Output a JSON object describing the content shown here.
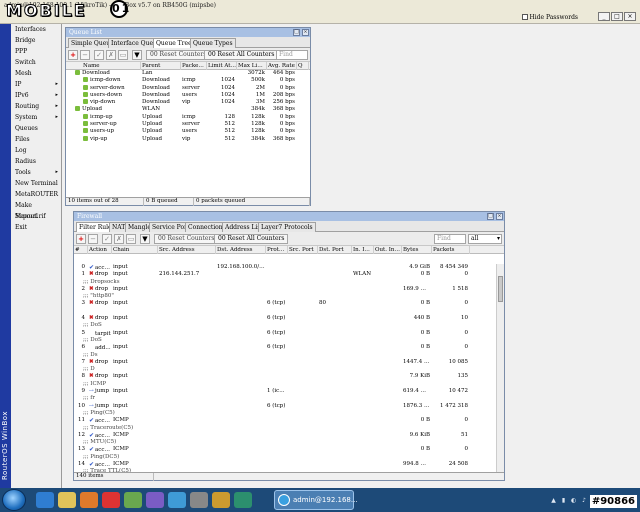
{
  "window": {
    "title": "admin@192.168.100.1 (MikroTik) - WinBox v5.7 on RB450G (mipsbe)",
    "hide_passwords": "Hide Passwords",
    "brand_vertical": "RouterOS WinBox"
  },
  "logo": {
    "text": "MOBILE",
    "badge": "01"
  },
  "menu": [
    {
      "label": "Interfaces",
      "arrow": ""
    },
    {
      "label": "Bridge",
      "arrow": ""
    },
    {
      "label": "PPP",
      "arrow": ""
    },
    {
      "label": "Switch",
      "arrow": ""
    },
    {
      "label": "Mesh",
      "arrow": ""
    },
    {
      "label": "IP",
      "arrow": "▸"
    },
    {
      "label": "IPv6",
      "arrow": "▸"
    },
    {
      "label": "Routing",
      "arrow": "▸"
    },
    {
      "label": "System",
      "arrow": "▸"
    },
    {
      "label": "Queues",
      "arrow": ""
    },
    {
      "label": "Files",
      "arrow": ""
    },
    {
      "label": "Log",
      "arrow": ""
    },
    {
      "label": "Radius",
      "arrow": ""
    },
    {
      "label": "Tools",
      "arrow": "▸"
    },
    {
      "label": "New Terminal",
      "arrow": ""
    },
    {
      "label": "MetaROUTER",
      "arrow": ""
    },
    {
      "label": "Make Supout.rif",
      "arrow": ""
    },
    {
      "label": "Manual",
      "arrow": ""
    },
    {
      "label": "Exit",
      "arrow": ""
    }
  ],
  "queue": {
    "title": "Queue List",
    "tabs": [
      "Simple Queues",
      "Interface Queues",
      "Queue Tree",
      "Queue Types"
    ],
    "active_tab": 2,
    "reset_counters": "Reset Counters",
    "reset_all_counters": "Reset All Counters",
    "find_placeholder": "Find",
    "columns": [
      "Name",
      "Parent",
      "Packet ...",
      "Limit At (...",
      "Max Limi...",
      "Avg. Rate",
      "Q"
    ],
    "rows": [
      {
        "name": "Download",
        "parent": "Lan",
        "packet": "",
        "limit": "",
        "max": "3072k",
        "avg": "464 bps",
        "indent": 1
      },
      {
        "name": "icmp-down",
        "parent": "Download",
        "packet": "icmp",
        "limit": "1024",
        "max": "500k",
        "avg": "0 bps",
        "indent": 2
      },
      {
        "name": "server-down",
        "parent": "Download",
        "packet": "server",
        "limit": "1024",
        "max": "2M",
        "avg": "0 bps",
        "indent": 2
      },
      {
        "name": "users-down",
        "parent": "Download",
        "packet": "users",
        "limit": "1024",
        "max": "1M",
        "avg": "208 bps",
        "indent": 2
      },
      {
        "name": "vip-down",
        "parent": "Download",
        "packet": "vip",
        "limit": "1024",
        "max": "3M",
        "avg": "256 bps",
        "indent": 2
      },
      {
        "name": "Upload",
        "parent": "WLAN",
        "packet": "",
        "limit": "",
        "max": "384k",
        "avg": "368 bps",
        "indent": 1
      },
      {
        "name": "icmp-up",
        "parent": "Upload",
        "packet": "icmp",
        "limit": "128",
        "max": "128k",
        "avg": "0 bps",
        "indent": 2
      },
      {
        "name": "server-up",
        "parent": "Upload",
        "packet": "server",
        "limit": "512",
        "max": "128k",
        "avg": "0 bps",
        "indent": 2
      },
      {
        "name": "users-up",
        "parent": "Upload",
        "packet": "users",
        "limit": "512",
        "max": "128k",
        "avg": "0 bps",
        "indent": 2
      },
      {
        "name": "vip-up",
        "parent": "Upload",
        "packet": "vip",
        "limit": "512",
        "max": "384k",
        "avg": "368 bps",
        "indent": 2
      }
    ],
    "status": [
      "10 items out of 28",
      "0 B queued",
      "0 packets queued"
    ]
  },
  "firewall": {
    "title": "Firewall",
    "tabs": [
      "Filter Rules",
      "NAT",
      "Mangle",
      "Service Ports",
      "Connections",
      "Address Lists",
      "Layer7 Protocols"
    ],
    "active_tab": 0,
    "reset_counters": "Reset Counters",
    "reset_all_counters": "Reset All Counters",
    "find_placeholder": "Find",
    "filter_value": "all",
    "columns": [
      "#",
      "Action",
      "Chain",
      "Src. Address",
      "Dst. Address",
      "Proto...",
      "Src. Port",
      "Dst. Port",
      "In. Inte...",
      "Out. Int...",
      "Bytes",
      "Packets"
    ],
    "rows": [
      {
        "type": "rule",
        "num": "0",
        "action": "accept",
        "icon": "chk",
        "chain": "input",
        "src": "",
        "dst": "192.168.100.0/24",
        "proto": "",
        "sport": "",
        "dport": "",
        "in": "",
        "out": "",
        "bytes": "4.9 GiB",
        "packets": "8 454 349"
      },
      {
        "type": "rule",
        "num": "1",
        "action": "drop",
        "icon": "x",
        "chain": "input",
        "src": "216.144.251.7",
        "dst": "",
        "proto": "",
        "sport": "",
        "dport": "",
        "in": "WLAN",
        "out": "",
        "bytes": "0 B",
        "packets": "0"
      },
      {
        "type": "comment",
        "text": ";;; Dropsocks"
      },
      {
        "type": "rule",
        "num": "2",
        "action": "drop",
        "icon": "x",
        "chain": "input",
        "src": "",
        "dst": "",
        "proto": "",
        "sport": "",
        "dport": "",
        "in": "",
        "out": "",
        "bytes": "169.9 KiB",
        "packets": "1 518"
      },
      {
        "type": "comment",
        "text": ";;; \"http80\""
      },
      {
        "type": "rule",
        "num": "3",
        "action": "drop",
        "icon": "x",
        "chain": "input",
        "src": "",
        "dst": "",
        "proto": "6 (tcp)",
        "sport": "",
        "dport": "80",
        "in": "",
        "out": "",
        "bytes": "0 B",
        "packets": "0"
      },
      {
        "type": "comment",
        "text": ""
      },
      {
        "type": "rule",
        "num": "4",
        "action": "drop",
        "icon": "x",
        "chain": "input",
        "src": "",
        "dst": "",
        "proto": "6 (tcp)",
        "sport": "",
        "dport": "",
        "in": "",
        "out": "",
        "bytes": "440 B",
        "packets": "10"
      },
      {
        "type": "comment",
        "text": ";;; DoS"
      },
      {
        "type": "rule",
        "num": "5",
        "action": "tarpit",
        "icon": "",
        "chain": "input",
        "src": "",
        "dst": "",
        "proto": "6 (tcp)",
        "sport": "",
        "dport": "",
        "in": "",
        "out": "",
        "bytes": "0 B",
        "packets": "0"
      },
      {
        "type": "comment",
        "text": ";;; DoS"
      },
      {
        "type": "rule",
        "num": "6",
        "action": "add...",
        "icon": "",
        "chain": "input",
        "src": "",
        "dst": "",
        "proto": "6 (tcp)",
        "sport": "",
        "dport": "",
        "in": "",
        "out": "",
        "bytes": "0 B",
        "packets": "0"
      },
      {
        "type": "comment",
        "text": ";;; Ds"
      },
      {
        "type": "rule",
        "num": "7",
        "action": "drop",
        "icon": "x",
        "chain": "input",
        "src": "",
        "dst": "",
        "proto": "",
        "sport": "",
        "dport": "",
        "in": "",
        "out": "",
        "bytes": "1447.4 KiB",
        "packets": "10 085"
      },
      {
        "type": "comment",
        "text": ";;; D"
      },
      {
        "type": "rule",
        "num": "8",
        "action": "drop",
        "icon": "x",
        "chain": "input",
        "src": "",
        "dst": "",
        "proto": "",
        "sport": "",
        "dport": "",
        "in": "",
        "out": "",
        "bytes": "7.9 KiB",
        "packets": "135"
      },
      {
        "type": "comment",
        "text": ";;; ICMP"
      },
      {
        "type": "rule",
        "num": "9",
        "action": "jump",
        "icon": "jmp",
        "chain": "input",
        "src": "",
        "dst": "",
        "proto": "1 (ic...",
        "sport": "",
        "dport": "",
        "in": "",
        "out": "",
        "bytes": "619.4 KiB",
        "packets": "10 472"
      },
      {
        "type": "comment",
        "text": ";;; fr"
      },
      {
        "type": "rule",
        "num": "10",
        "action": "jump",
        "icon": "jmp",
        "chain": "input",
        "src": "",
        "dst": "",
        "proto": "6 (tcp)",
        "sport": "",
        "dport": "",
        "in": "",
        "out": "",
        "bytes": "1876.3 M...",
        "packets": "1 472 318"
      },
      {
        "type": "comment",
        "text": ";;; Ping(C5)"
      },
      {
        "type": "rule",
        "num": "11",
        "action": "accept",
        "icon": "chk",
        "chain": "ICMP",
        "src": "",
        "dst": "",
        "proto": "",
        "sport": "",
        "dport": "",
        "in": "",
        "out": "",
        "bytes": "0 B",
        "packets": "0"
      },
      {
        "type": "comment",
        "text": ";;; Traceroute(C5)"
      },
      {
        "type": "rule",
        "num": "12",
        "action": "accept",
        "icon": "chk",
        "chain": "ICMP",
        "src": "",
        "dst": "",
        "proto": "",
        "sport": "",
        "dport": "",
        "in": "",
        "out": "",
        "bytes": "9.6 KiB",
        "packets": "51"
      },
      {
        "type": "comment",
        "text": ";;; MTU(C5)"
      },
      {
        "type": "rule",
        "num": "13",
        "action": "accept",
        "icon": "chk",
        "chain": "ICMP",
        "src": "",
        "dst": "",
        "proto": "",
        "sport": "",
        "dport": "",
        "in": "",
        "out": "",
        "bytes": "0 B",
        "packets": "0"
      },
      {
        "type": "comment",
        "text": ";;; Ping(DC5)"
      },
      {
        "type": "rule",
        "num": "14",
        "action": "accept",
        "icon": "chk",
        "chain": "ICMP",
        "src": "",
        "dst": "",
        "proto": "",
        "sport": "",
        "dport": "",
        "in": "",
        "out": "",
        "bytes": "994.8 KiB",
        "packets": "24 508"
      },
      {
        "type": "comment",
        "text": ";;; Trace TTL(C5)"
      }
    ],
    "status": "140 items"
  },
  "taskbar": {
    "window_label": "admin@192.168...",
    "watermark": "#90866"
  }
}
